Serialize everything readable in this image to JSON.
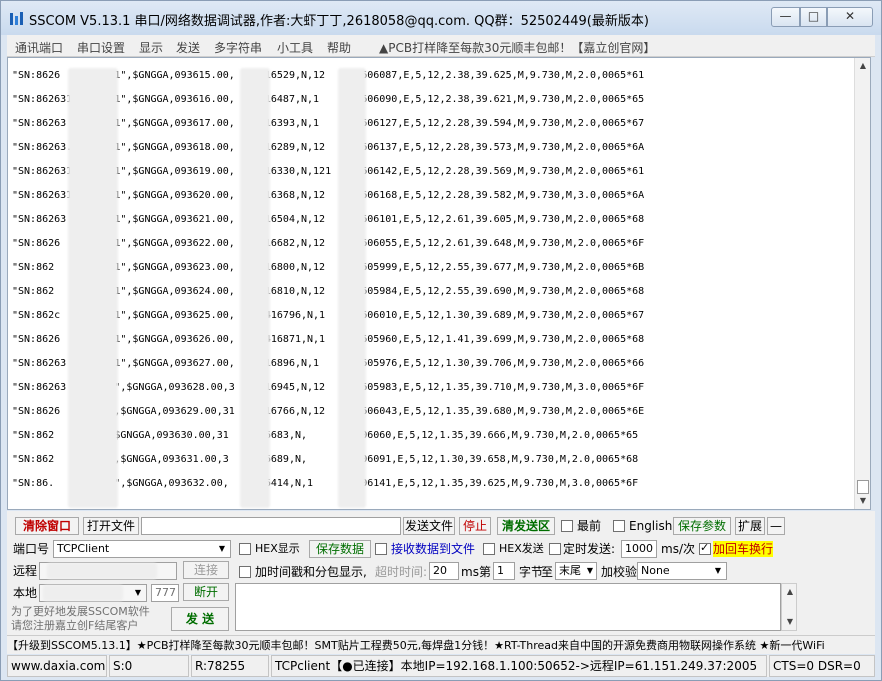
{
  "window": {
    "title": "SSCOM V5.13.1 串口/网络数据调试器,作者:大虾丁丁,2618058@qq.com. QQ群：52502449(最新版本)",
    "min": "—",
    "max": "□",
    "close": "✕"
  },
  "menu": {
    "items": [
      "通讯端口",
      "串口设置",
      "显示",
      "发送",
      "多字符串",
      "小工具",
      "帮助"
    ],
    "promo": "▲PCB打样降至每款30元顺丰包邮！【嘉立创官网】"
  },
  "receive": {
    "lines": [
      "\"SN:8626      5871\",$GNGGA,093615.00,  .3416529,N,12     3606087,E,5,12,2.38,39.625,M,9.730,M,2.0,0065*61",
      "\"SN:862631    5871\",$GNGGA,093616.00,  .3416487,N,1      3606090,E,5,12,2.38,39.621,M,9.730,M,2.0,0065*65",
      "\"SN:86263     5871\",$GNGGA,093617.00,  .3416393,N,1      3606127,E,5,12,2.28,39.594,M,9.730,M,2.0,0065*67",
      "\"SN:86263.   15871\",$GNGGA,093618.00,  .3416289,N,12     3606137,E,5,12,2.28,39.573,M,9.730,M,2.0,0065*6A",
      "\"SN:862631   15871\",$GNGGA,093619.00,  .3416330,N,121    3606142,E,5,12,2.28,39.569,M,9.730,M,2.0,0065*61",
      "\"SN:862631   15871\",$GNGGA,093620.00,  .3416368,N,12     3606168,E,5,12,2.28,39.582,M,9.730,M,3.0,0065*6A",
      "\"SN:86263    15871\",$GNGGA,093621.00,  .3416504,N,12     3606101,E,5,12,2.61,39.605,M,9.730,M,2.0,0065*68",
      "\"SN:8626      5871\",$GNGGA,093622.00,  .3416682,N,12     3606055,E,5,12,2.61,39.648,M,9.730,M,2.0,0065*6F",
      "\"SN:862       5871\",$GNGGA,093623.00,  .3416800,N,12     3605999,E,5,12,2.55,39.677,M,9.730,M,2.0,0065*6B",
      "\"SN:862       5871\",$GNGGA,093624.00,  .3416810,N,12     3605984,E,5,12,2.55,39.690,M,9.730,M,2.0,0065*68",
      "\"SN:862c      5871\",$GNGGA,093625.00,  8.3416796,N,1     3606010,E,5,12,1.30,39.689,M,9.730,M,2.0,0065*67",
      "\"SN:8626      5871\",$GNGGA,093626.00,  8.3416871,N,1     3605960,E,5,12,1.41,39.699,M,9.730,M,2.0,0065*68",
      "\"SN:86263      871\",$GNGGA,093627.00,  .3416896,N,1      3605976,E,5,12,1.30,39.706,M,9.730,M,2.0,0065*66",
      "\"SN:86263      71\",$GNGGA,093628.00,3  .3416945,N,12     3605983,E,5,12,1.35,39.710,M,9.730,M,3.0,0065*6F",
      "\"SN:8626       1\",$GNGGA,093629.00,31  .3416766,N,12     3606043,E,5,12,1.35,39.680,M,9.730,M,2.0,0065*6E",
      "\"SN:862       1\",$GNGGA,093630.00,31  .3416683,N,       3606060,E,5,12,1.35,39.666,M,9.730,M,2.0,0065*65",
      "\"SN:862        1\",$GNGGA,093631.00,3  .3416689,N,       3606091,E,5,12,1.30,39.658,M,9.730,M,2.0,0065*68",
      "\"SN:86.        71\",$GNGGA,093632.00,  .3416414,N,1      3606141,E,5,12,1.35,39.625,M,9.730,M,3.0,0065*6F"
    ]
  },
  "toolbar": {
    "clear_window": "清除窗口",
    "open_file": "打开文件",
    "send_file": "发送文件",
    "stop": "停止",
    "clear_send": "清发送区",
    "topmost": "最前",
    "english": "English",
    "save_params": "保存参数",
    "expand": "扩展",
    "collapse": "—"
  },
  "port": {
    "label": "端口号",
    "value": "TCPClient",
    "hex_display": "HEX显示",
    "save_data": "保存数据",
    "recv_to_file": "接收数据到文件",
    "hex_send": "HEX发送",
    "timed_send": "定时发送:",
    "interval": "1000",
    "interval_unit": "ms/次",
    "add_crlf": "加回车换行"
  },
  "remote": {
    "label": "远程",
    "connect": "连接",
    "timestamp": "加时间戳和分包显示,",
    "timeout_label": "超时时间:",
    "timeout_value": "20",
    "timeout_unit": "ms",
    "nth_label": "第",
    "nth_value": "1",
    "byte_label": "字节",
    "to_label": "至",
    "end_value": "末尾",
    "checksum_label": "加校验",
    "checksum_value": "None"
  },
  "local": {
    "label": "本地",
    "port_value": "777",
    "disconnect": "断开"
  },
  "promo_note": {
    "line1": "为了更好地发展SSCOM软件",
    "line2": "请您注册嘉立创F结尾客户",
    "send": "发 送"
  },
  "ticker": "【升级到SSCOM5.13.1】★PCB打样降至每款30元顺丰包邮！SMT贴片工程费50元,每焊盘1分钱！★RT-Thread来自中国的开源免费商用物联网操作系统 ★新一代WiFi",
  "status": {
    "site": "www.daxia.com",
    "sent": "S:0",
    "received": "R:78255",
    "connection": "TCPclient【●已连接】本地IP=192.168.1.100:50652->远程IP=61.151.249.37:2005",
    "signals": "CTS=0 DSR=0"
  },
  "colors": {
    "accent_red": "#c00000",
    "accent_green": "#006e00",
    "accent_blue": "#0000c0",
    "crlf_highlight": "#ffff00"
  }
}
